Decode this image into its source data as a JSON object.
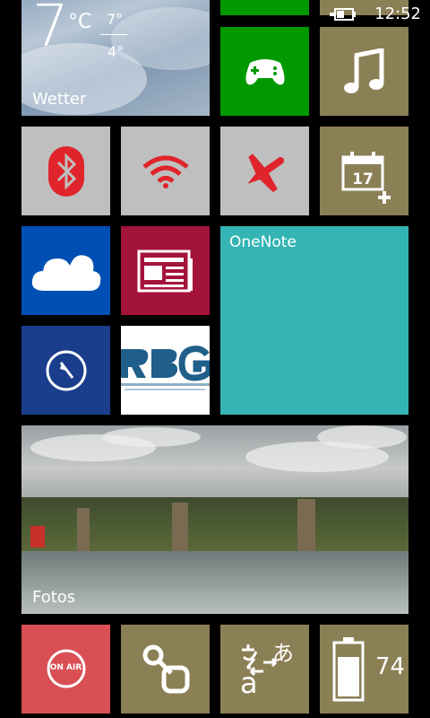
{
  "status_bar": {
    "time": "12:52"
  },
  "colors": {
    "accent_gray": "#BFBFBF",
    "olive": "#8B7F55",
    "green": "#009900",
    "blue": "#0050B3",
    "red_magenta": "#A4133A",
    "teal": "#35B4B4",
    "navy": "#1A3E8C",
    "salmon": "#D94F54",
    "icon_red": "#E0242B"
  },
  "tiles": {
    "weather": {
      "label": "Wetter",
      "temp": "7",
      "unit": "°C",
      "high": "7°",
      "low": "4°"
    },
    "xbox": {
      "icon": "gamepad-icon"
    },
    "music": {
      "icon": "music-note-icon"
    },
    "bluetooth": {
      "icon": "bluetooth-icon"
    },
    "wifi": {
      "icon": "wifi-icon"
    },
    "airplane": {
      "icon": "airplane-icon"
    },
    "calendar": {
      "icon": "calendar-icon",
      "day": "17"
    },
    "onedrive": {
      "icon": "cloud-icon"
    },
    "news": {
      "icon": "newspaper-icon"
    },
    "onenote": {
      "label": "OneNote"
    },
    "compass": {
      "icon": "compass-icon"
    },
    "rbg": {
      "icon": "rbg-logo"
    },
    "photos": {
      "label": "Fotos"
    },
    "on_air": {
      "icon": "on-air-icon",
      "text": "ON AIR"
    },
    "link": {
      "icon": "link-icon"
    },
    "translator": {
      "icon": "translate-icon"
    },
    "battery": {
      "icon": "battery-icon",
      "percent": "74"
    }
  }
}
